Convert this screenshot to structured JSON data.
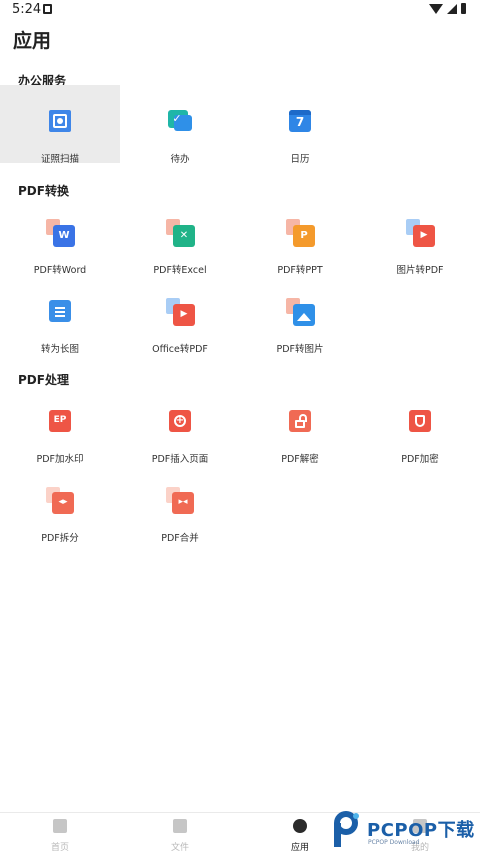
{
  "status_bar": {
    "time": "5:24"
  },
  "page": {
    "title": "应用"
  },
  "sections": {
    "office": {
      "title": "办公服务",
      "items": [
        {
          "label": "证照扫描",
          "icon": "id-scan-icon"
        },
        {
          "label": "待办",
          "icon": "todo-icon"
        },
        {
          "label": "日历",
          "icon": "calendar-icon",
          "icon_text": "7"
        }
      ]
    },
    "convert": {
      "title": "PDF转换",
      "items": [
        {
          "label": "PDF转Word",
          "icon": "pdf-to-word-icon",
          "icon_text": "W"
        },
        {
          "label": "PDF转Excel",
          "icon": "pdf-to-excel-icon",
          "icon_text": "✕"
        },
        {
          "label": "PDF转PPT",
          "icon": "pdf-to-ppt-icon",
          "icon_text": "P"
        },
        {
          "label": "图片转PDF",
          "icon": "image-to-pdf-icon",
          "icon_text": "▶"
        },
        {
          "label": "转为长图",
          "icon": "to-long-image-icon"
        },
        {
          "label": "Office转PDF",
          "icon": "office-to-pdf-icon",
          "icon_text": "▶"
        },
        {
          "label": "PDF转图片",
          "icon": "pdf-to-image-icon"
        }
      ]
    },
    "process": {
      "title": "PDF处理",
      "items": [
        {
          "label": "PDF加水印",
          "icon": "pdf-watermark-icon",
          "icon_text": "EP"
        },
        {
          "label": "PDF插入页面",
          "icon": "pdf-insert-page-icon",
          "icon_text": "+"
        },
        {
          "label": "PDF解密",
          "icon": "pdf-decrypt-icon"
        },
        {
          "label": "PDF加密",
          "icon": "pdf-encrypt-icon"
        },
        {
          "label": "PDF拆分",
          "icon": "pdf-split-icon"
        },
        {
          "label": "PDF合并",
          "icon": "pdf-merge-icon"
        }
      ]
    }
  },
  "bottom_nav": {
    "items": [
      {
        "label": "首页",
        "icon": "home-icon",
        "active": false
      },
      {
        "label": "文件",
        "icon": "folder-icon",
        "active": false
      },
      {
        "label": "应用",
        "icon": "apps-icon",
        "active": true
      },
      {
        "label": "我的",
        "icon": "profile-icon",
        "active": false
      }
    ]
  },
  "watermark": {
    "brand": "PCPOP下载",
    "sub": "PCPOP Download"
  },
  "colors": {
    "blue": "#2f7fe6",
    "teal": "#1fb6a8",
    "green": "#20b388",
    "orange": "#f49a2c",
    "red": "#ee5545",
    "coral": "#f06a54",
    "light_blue": "#7fb6f5",
    "active_bg": "#ebebeb"
  }
}
